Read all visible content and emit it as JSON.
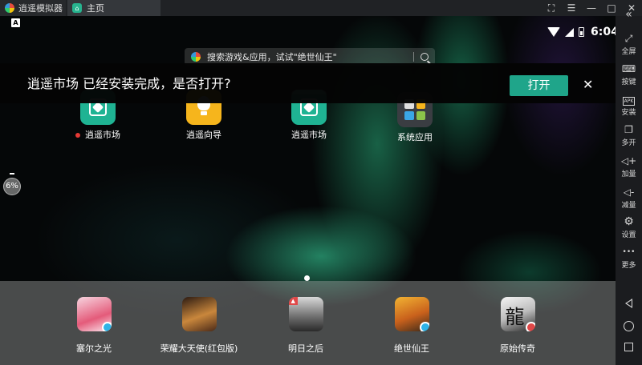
{
  "window": {
    "app_title": "逍遥模拟器",
    "home_tab_label": "主页",
    "controls": [
      "⛶",
      "☰",
      "—",
      "□",
      "✕"
    ]
  },
  "status_bar": {
    "indicator": "A",
    "time": "6:04"
  },
  "search": {
    "placeholder": "搜索游戏&应用，试试\"绝世仙王\""
  },
  "banner": {
    "message": "逍遥市场 已经安装完成，是否打开?",
    "open_label": "打开",
    "close_symbol": "✕"
  },
  "desktop": {
    "apps": [
      {
        "label": "逍遥市场",
        "new_badge": true
      },
      {
        "label": "逍遥向导"
      },
      {
        "label": "逍遥市场"
      },
      {
        "label": "系统应用"
      }
    ],
    "float_ball_text": "6%"
  },
  "dock": {
    "apps": [
      {
        "label": "塞尔之光"
      },
      {
        "label": "荣耀大天使(红包版)"
      },
      {
        "label": "明日之后"
      },
      {
        "label": "绝世仙王"
      },
      {
        "label": "原始传奇"
      }
    ]
  },
  "toolbar": {
    "collapse_symbol": "«",
    "items": [
      {
        "icon": "fullscreen-icon",
        "symbol": "⤢",
        "label": "全屏"
      },
      {
        "icon": "keyboard-icon",
        "symbol": "⌨",
        "label": "按键"
      },
      {
        "icon": "apk-icon",
        "symbol": "APK",
        "label": "安装"
      },
      {
        "icon": "multi-instance-icon",
        "symbol": "❐",
        "label": "多开"
      },
      {
        "icon": "volume-up-icon",
        "symbol": "◁+",
        "label": "加量"
      },
      {
        "icon": "volume-down-icon",
        "symbol": "◁-",
        "label": "减量"
      },
      {
        "icon": "settings-icon",
        "symbol": "⚙",
        "label": "设置"
      },
      {
        "icon": "more-icon",
        "symbol": "•••",
        "label": "更多"
      }
    ]
  },
  "colors": {
    "accent": "#1fa58a",
    "toolbar_bg": "#1b1c1f",
    "titlebar_bg": "#202225"
  }
}
